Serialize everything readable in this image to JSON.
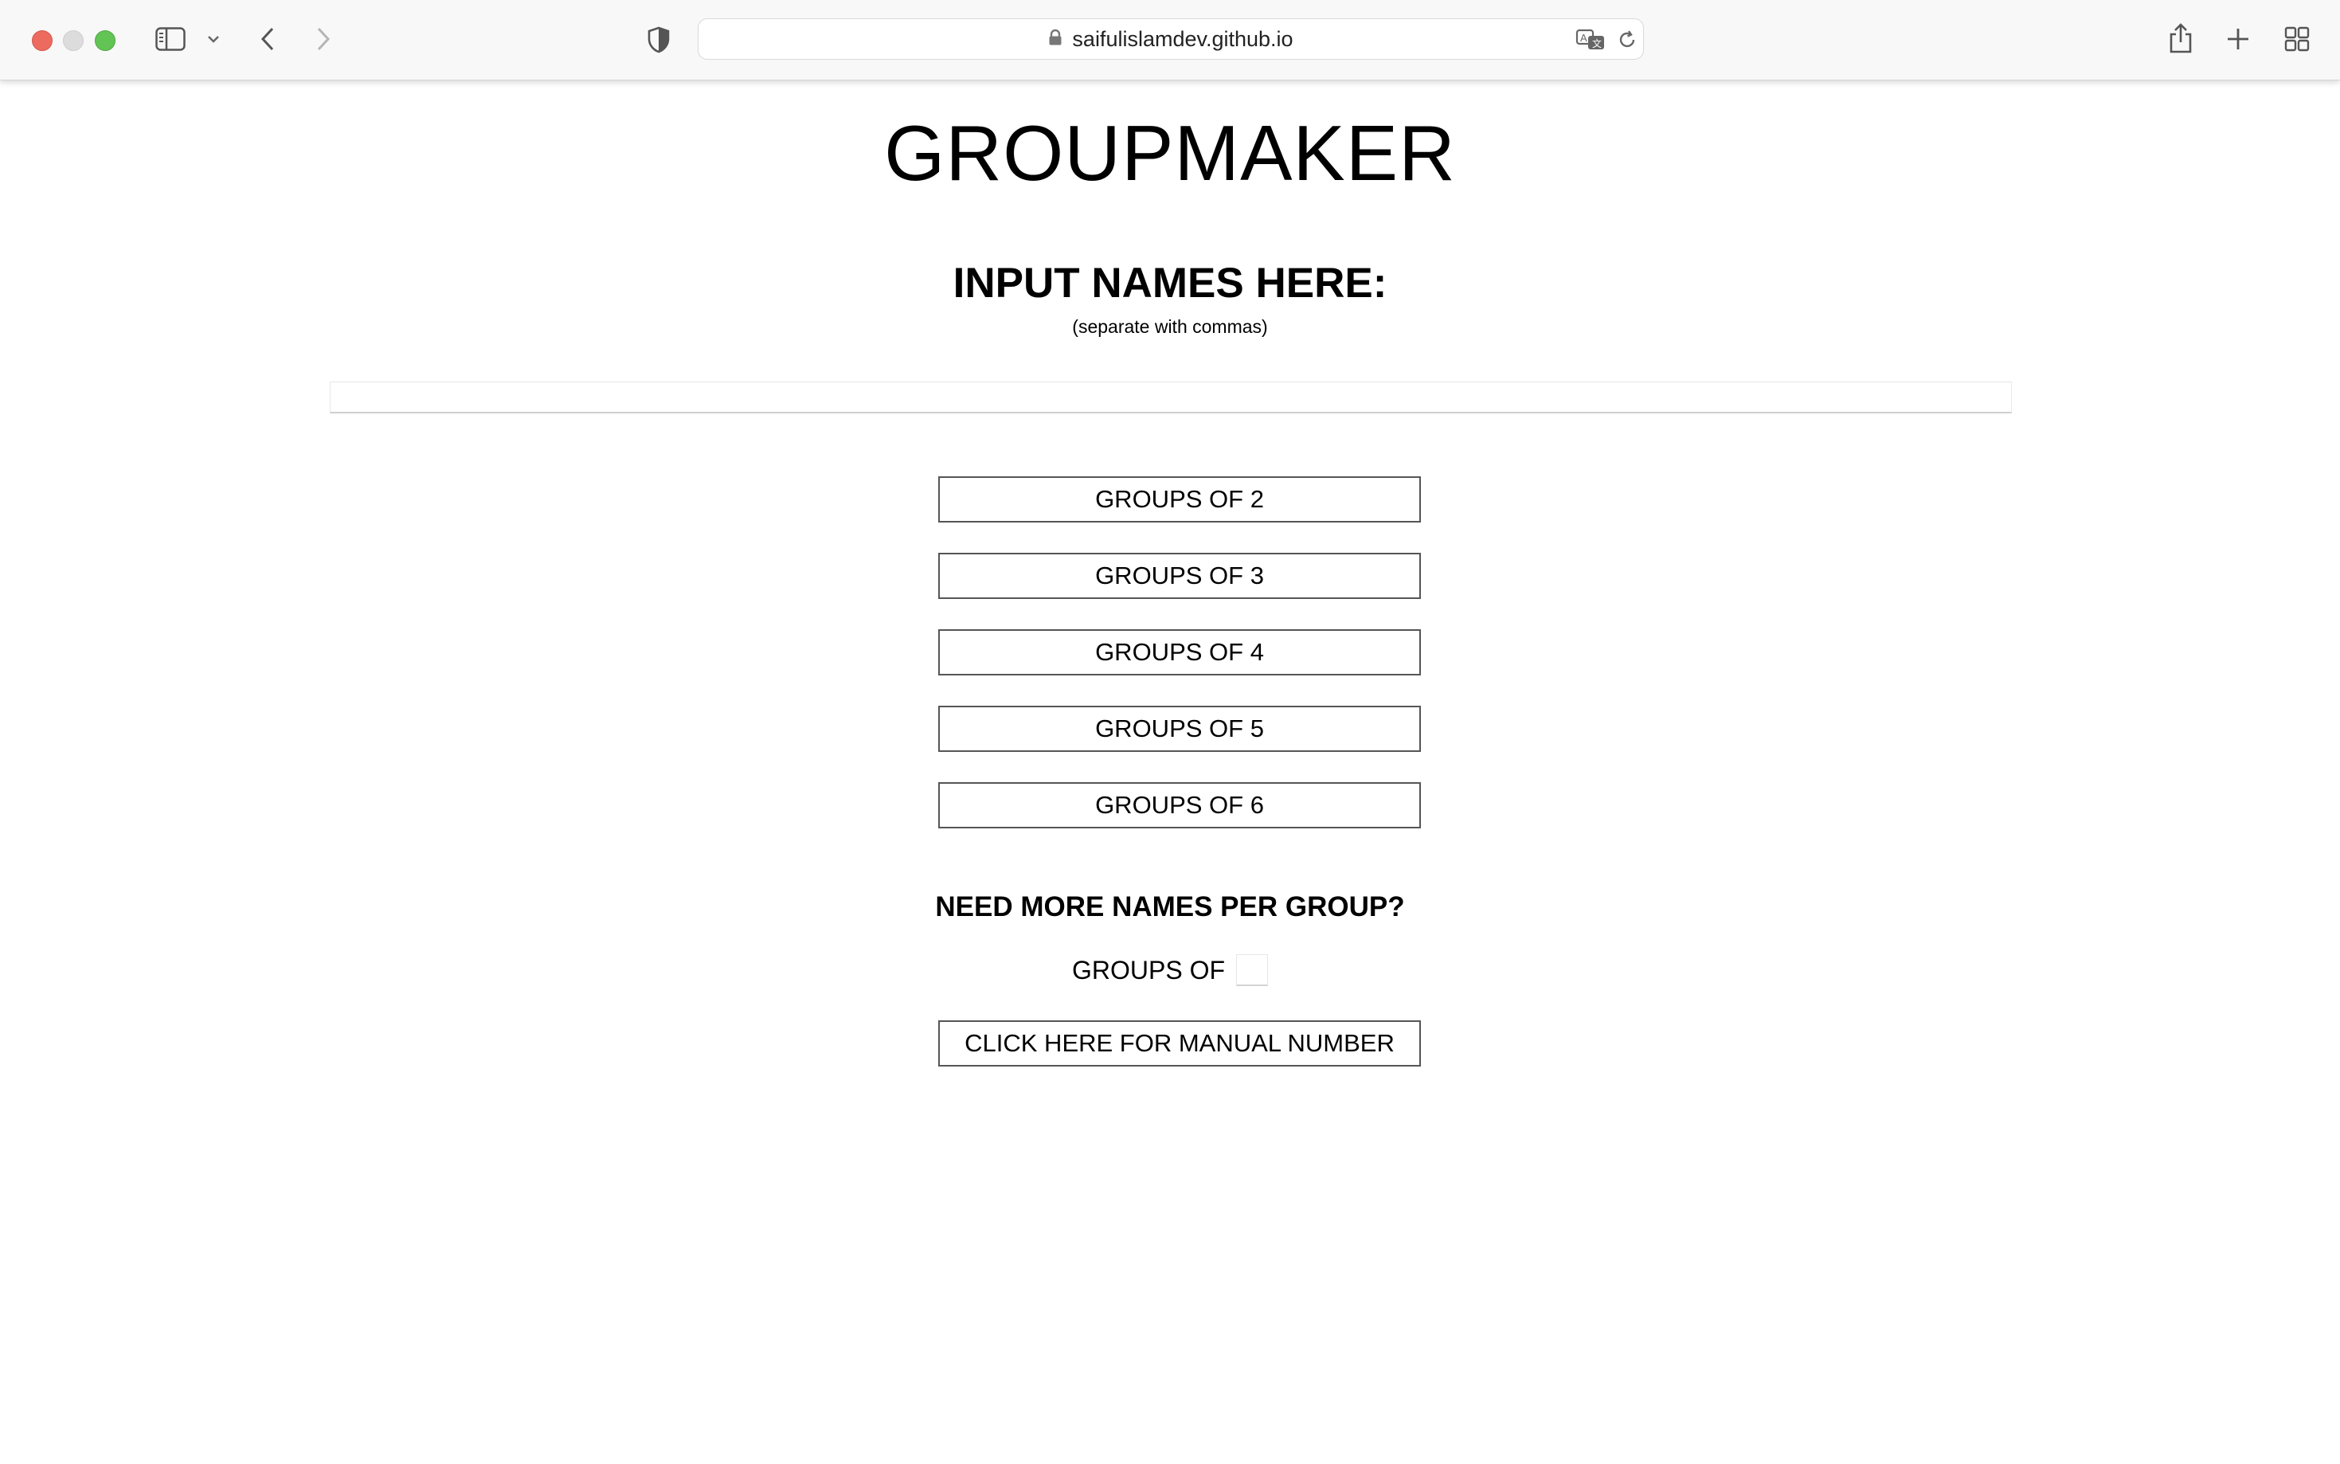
{
  "browser": {
    "url": "saifulislamdev.github.io",
    "icons": {
      "sidebar": "sidebar-icon",
      "sidebar_menu": "chevron-down-icon",
      "back": "chevron-left-icon",
      "forward": "chevron-right-icon",
      "privacy": "shield-icon",
      "lock": "lock-icon",
      "translate": "translate-icon",
      "reload": "reload-icon",
      "share": "share-icon",
      "new_tab": "plus-icon",
      "tab_overview": "grid-icon"
    },
    "colors": {
      "close": "#ed6a5e",
      "minimize": "#dcdcdc",
      "maximize": "#61c454"
    }
  },
  "page": {
    "title": "GROUPMAKER",
    "input_heading": "INPUT NAMES HERE:",
    "input_hint": "(separate with commas)",
    "names_value": "",
    "names_placeholder": "",
    "buttons": [
      {
        "label": "GROUPS OF 2"
      },
      {
        "label": "GROUPS OF 3"
      },
      {
        "label": "GROUPS OF 4"
      },
      {
        "label": "GROUPS OF 5"
      },
      {
        "label": "GROUPS OF 6"
      }
    ],
    "more_heading": "NEED MORE NAMES PER GROUP?",
    "manual_label": "GROUPS OF",
    "manual_value": "",
    "manual_button": "CLICK HERE FOR MANUAL NUMBER"
  }
}
